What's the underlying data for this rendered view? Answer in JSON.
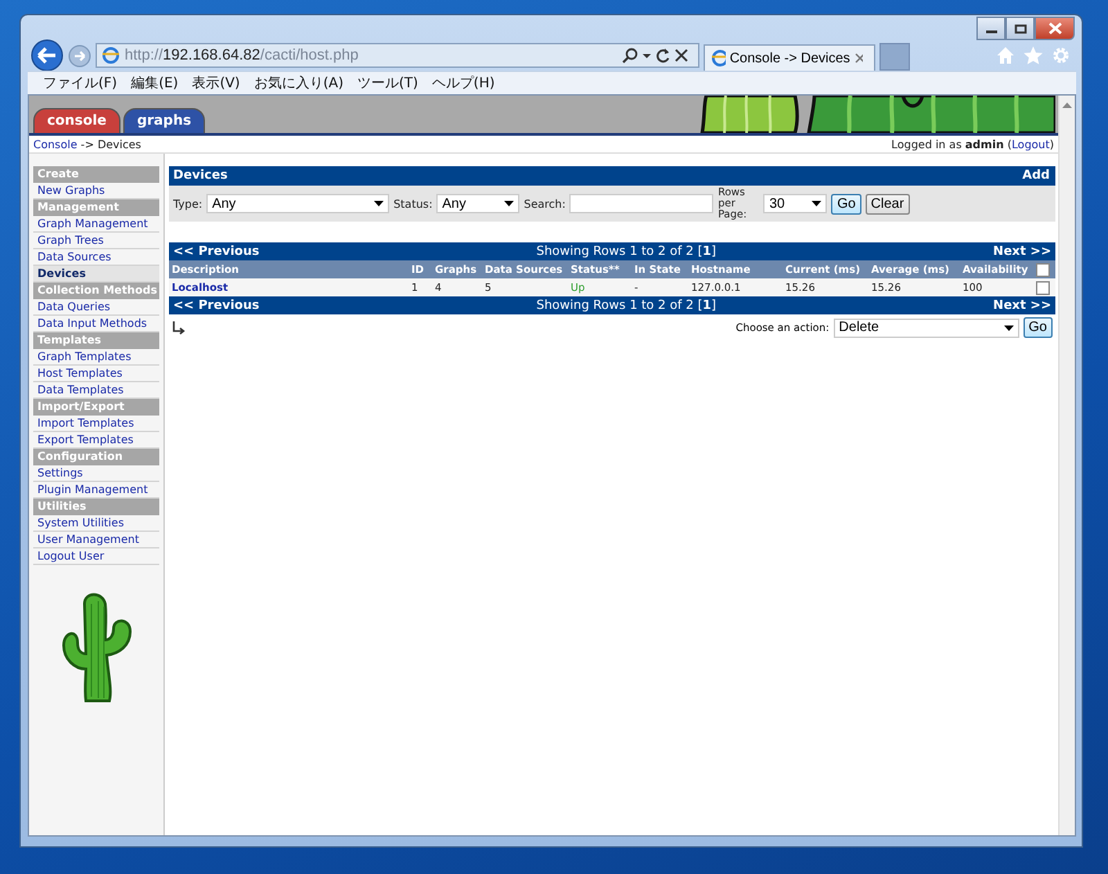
{
  "browser": {
    "url": {
      "scheme": "http://",
      "host": "192.168.64.82",
      "path": "/cacti/host.php"
    },
    "tab_title": "Console -> Devices",
    "menu": [
      "ファイル(F)",
      "編集(E)",
      "表示(V)",
      "お気に入り(A)",
      "ツール(T)",
      "ヘルプ(H)"
    ]
  },
  "cacti_tabs": [
    {
      "label": "console",
      "color": "#c8403c"
    },
    {
      "label": "graphs",
      "color": "#2e52a6"
    }
  ],
  "breadcrumb": {
    "link": "Console",
    "rest": " -> Devices"
  },
  "login": {
    "prefix": "Logged in as **admin** (",
    "link": "Logout",
    "suffix": ")"
  },
  "sidebar": [
    {
      "heading": "Create",
      "items": [
        {
          "label": "New Graphs",
          "selected": false
        }
      ]
    },
    {
      "heading": "Management",
      "items": [
        {
          "label": "Graph Management",
          "selected": false
        },
        {
          "label": "Graph Trees",
          "selected": false
        },
        {
          "label": "Data Sources",
          "selected": false
        },
        {
          "label": "Devices",
          "selected": true
        }
      ]
    },
    {
      "heading": "Collection Methods",
      "items": [
        {
          "label": "Data Queries",
          "selected": false
        },
        {
          "label": "Data Input Methods",
          "selected": false
        }
      ]
    },
    {
      "heading": "Templates",
      "items": [
        {
          "label": "Graph Templates",
          "selected": false
        },
        {
          "label": "Host Templates",
          "selected": false
        },
        {
          "label": "Data Templates",
          "selected": false
        }
      ]
    },
    {
      "heading": "Import/Export",
      "items": [
        {
          "label": "Import Templates",
          "selected": false
        },
        {
          "label": "Export Templates",
          "selected": false
        }
      ]
    },
    {
      "heading": "Configuration",
      "items": [
        {
          "label": "Settings",
          "selected": false
        },
        {
          "label": "Plugin Management",
          "selected": false
        }
      ]
    },
    {
      "heading": "Utilities",
      "items": [
        {
          "label": "System Utilities",
          "selected": false
        },
        {
          "label": "User Management",
          "selected": false
        },
        {
          "label": "Logout User",
          "selected": false
        }
      ]
    }
  ],
  "panel": {
    "title": "Devices",
    "add": "Add",
    "filters": {
      "type_label": "Type:",
      "type_value": "Any",
      "status_label": "Status:",
      "status_value": "Any",
      "search_label": "Search:",
      "rows_label": "Rows per Page:",
      "rows_value": "30",
      "go": "Go",
      "clear": "Clear"
    }
  },
  "nav_bars": [
    {
      "previous": "<< Previous",
      "showing": "Showing Rows 1 to 2 of 2 [**1**]",
      "next": "Next >>"
    },
    {
      "previous": "<< Previous",
      "showing": "Showing Rows 1 to 2 of 2 [**1**]",
      "next": "Next >>"
    }
  ],
  "table": {
    "columns": [
      "Description",
      "ID",
      "Graphs",
      "Data Sources",
      "Status**",
      "In State",
      "Hostname",
      "Current (ms)",
      "Average (ms)",
      "Availability"
    ],
    "select_all_checked": false,
    "rows": [
      {
        "cells": [
          "Localhost",
          "1",
          "4",
          "5",
          "Up",
          "-",
          "127.0.0.1",
          "15.26",
          "15.26",
          "100"
        ],
        "color": "#2e9e2e",
        "checked": false
      }
    ]
  },
  "action": {
    "label": "Choose an action:",
    "value": "Delete",
    "go": "Go"
  }
}
